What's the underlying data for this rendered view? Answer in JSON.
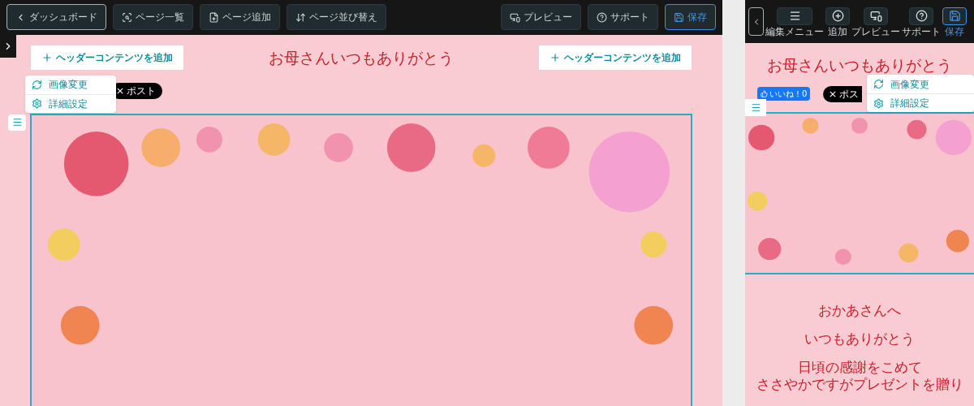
{
  "editor": {
    "toolbar_left": [
      {
        "kind": "back",
        "label": "ダッシュボード"
      },
      {
        "kind": "list",
        "label": "ページ一覧"
      },
      {
        "kind": "add",
        "label": "ページ追加"
      },
      {
        "kind": "sort",
        "label": "ページ並び替え"
      }
    ],
    "toolbar_right": [
      {
        "kind": "preview",
        "label": "プレビュー",
        "selected": false
      },
      {
        "kind": "support",
        "label": "サポート",
        "selected": false
      },
      {
        "kind": "save",
        "label": "保存",
        "selected": true
      }
    ],
    "header_buttons": [
      "ヘッダーコンテンツを追加",
      "ヘッダーコンテンツを追加"
    ],
    "title": "お母さんいつもありがとう",
    "post_badge": "ポスト",
    "image_menu": [
      {
        "kind": "change",
        "label": "画像変更"
      },
      {
        "kind": "settings",
        "label": "詳細設定"
      }
    ]
  },
  "mobile": {
    "toolbar": [
      {
        "kind": "menu",
        "label": "編集メニュー",
        "selected": false
      },
      {
        "kind": "add",
        "label": "追加",
        "selected": false
      },
      {
        "kind": "preview",
        "label": "プレビュー",
        "selected": false
      },
      {
        "kind": "support",
        "label": "サポート",
        "selected": false
      },
      {
        "kind": "save",
        "label": "保存",
        "selected": true
      }
    ],
    "title": "お母さんいつもありがとう",
    "like_badge": "いいね！0",
    "post_badge": "ポス",
    "image_menu": [
      {
        "kind": "change",
        "label": "画像変更"
      },
      {
        "kind": "settings",
        "label": "詳細設定"
      }
    ],
    "message_lines": [
      "おかあさんへ",
      "いつもありがとう",
      "日頃の感謝をこめて",
      "ささやかですがプレゼントを贈り"
    ]
  }
}
